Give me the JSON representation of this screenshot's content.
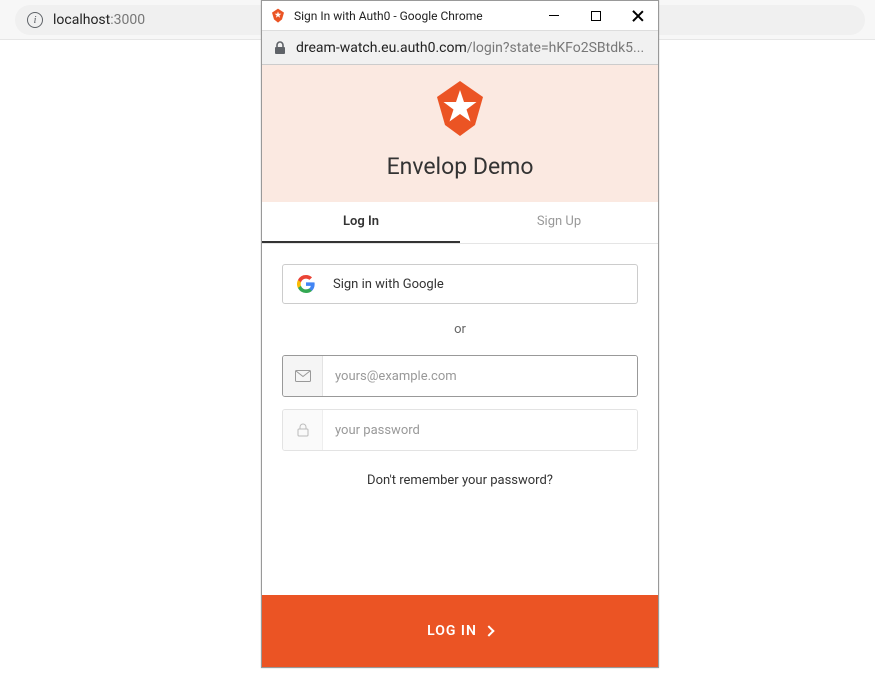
{
  "parent_browser": {
    "url_host": "localhost",
    "url_port": ":3000"
  },
  "popup": {
    "title": "Sign In with Auth0 - Google Chrome",
    "url_domain": "dream-watch.eu.auth0.com",
    "url_path": "/login?state=hKFo2SBtdk5..."
  },
  "auth": {
    "app_name": "Envelop Demo",
    "tabs": {
      "login": "Log In",
      "signup": "Sign Up"
    },
    "google_button": "Sign in with Google",
    "or_text": "or",
    "email_placeholder": "yours@example.com",
    "password_placeholder": "your password",
    "forgot_link": "Don't remember your password?",
    "submit_label": "LOG IN"
  }
}
